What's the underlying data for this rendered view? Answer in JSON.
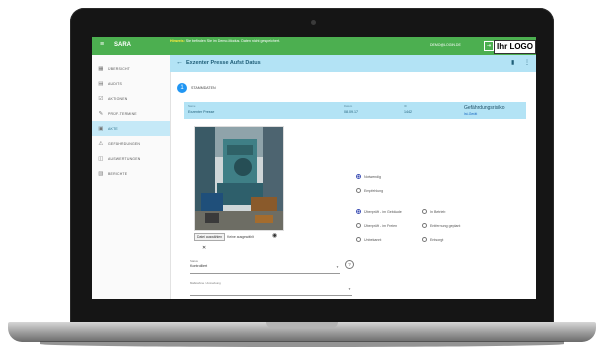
{
  "topbar": {
    "app_name": "SARA",
    "menu_icon": "menu-icon",
    "notice_strong": "Hinweis:",
    "notice_text": "Sie befinden Sie im Demo-Modus. Daten nicht gespeichert.",
    "user": "DEMO@LOGIN.DE",
    "logo": "Ihr LOGO"
  },
  "sidebar": {
    "items": [
      {
        "label": "ÜBERSICHT",
        "icon": "grid-icon"
      },
      {
        "label": "AUDITS",
        "icon": "clipboard-icon"
      },
      {
        "label": "AKTIONEN",
        "icon": "checklist-icon"
      },
      {
        "label": "PRÜF-TERMINE",
        "icon": "wrench-icon"
      },
      {
        "label": "AKTE",
        "icon": "folder-icon",
        "active": true
      },
      {
        "label": "GEFÄHRDUNGEN",
        "icon": "warning-icon"
      },
      {
        "label": "AUSWERTUNGEN",
        "icon": "chart-icon"
      },
      {
        "label": "BERICHTE",
        "icon": "document-icon"
      }
    ]
  },
  "header": {
    "title": "Exzenter Presse Aufst Datus",
    "right_icons": [
      "save-icon",
      "more-icon"
    ]
  },
  "stepper": {
    "number": "1",
    "label": "STAMMDATEN"
  },
  "info": {
    "name_label": "Name",
    "name_value": "Exzenter Presse",
    "date_label": "Datum",
    "date_value": "08.09.17",
    "id_label": "ID",
    "id_value": "1442",
    "section_title": "Gefährdungsrisiko",
    "section_sub": "Ist-Gerät"
  },
  "photo": {
    "file_button": "Datei auswählen",
    "file_none": "Keine ausgewählt"
  },
  "fields": [
    {
      "label": "Status",
      "value": "Kontrolliert"
    },
    {
      "label": "Maßnahme / Anmerkung",
      "value": ""
    }
  ],
  "radios": {
    "group1": [
      {
        "label": "Notwendig",
        "checked": true
      },
      {
        "label": "Empfehlung",
        "checked": false
      }
    ],
    "group2": [
      {
        "label": "Überprüft - im Gebäude",
        "checked": true
      },
      {
        "label": "Überprüft - im Freien",
        "checked": false
      },
      {
        "label": "Unbekannt",
        "checked": false
      }
    ],
    "group3": [
      {
        "label": "In Betrieb",
        "checked": false
      },
      {
        "label": "Entfernung geplant",
        "checked": false
      },
      {
        "label": "Entsorgt",
        "checked": false
      }
    ]
  },
  "colors": {
    "topbar": "#4caf50",
    "accent": "#b3e3f5",
    "primary": "#2196f3"
  }
}
